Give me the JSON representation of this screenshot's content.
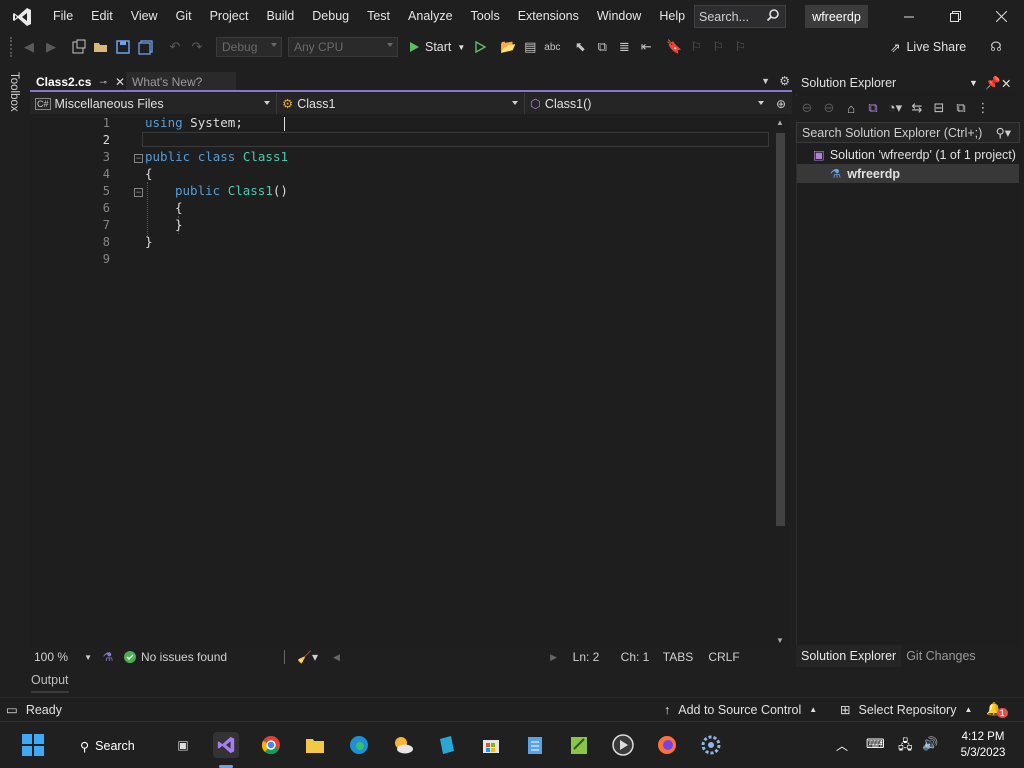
{
  "menu": [
    "File",
    "Edit",
    "View",
    "Git",
    "Project",
    "Build",
    "Debug",
    "Test",
    "Analyze",
    "Tools",
    "Extensions",
    "Window",
    "Help"
  ],
  "search": {
    "placeholder": "Search..."
  },
  "solution_badge": "wfreerdp",
  "toolbar": {
    "config": "Debug",
    "platform": "Any CPU",
    "start_label": "Start",
    "live_share": "Live Share"
  },
  "toolbox_label": "Toolbox",
  "tabs": [
    {
      "label": "Class2.cs",
      "active": true
    },
    {
      "label": "What's New?",
      "active": false
    }
  ],
  "navbar": {
    "project": "Miscellaneous Files",
    "type": "Class1",
    "member": "Class1()"
  },
  "code": {
    "line_numbers": [
      "1",
      "2",
      "3",
      "4",
      "5",
      "6",
      "7",
      "8",
      "9"
    ],
    "current_line": "2",
    "l1_kw": "using",
    "l1_rest": " System;",
    "l3_kw1": "public",
    "l3_kw2": "class",
    "l3_type": "Class1",
    "l4": "{",
    "l5_kw": "public",
    "l5_fn": "Class1",
    "l5_paren": "()",
    "l6": "{",
    "l7": "}",
    "l8": "}"
  },
  "editor_status": {
    "zoom": "100 %",
    "issues": "No issues found",
    "line": "Ln: 2",
    "char": "Ch: 1",
    "tabs": "TABS",
    "eol": "CRLF"
  },
  "output_label": "Output",
  "solution_explorer": {
    "title": "Solution Explorer",
    "search_placeholder": "Search Solution Explorer (Ctrl+;)",
    "solution_label": "Solution 'wfreerdp' (1 of 1 project)",
    "project_label": "wfreerdp",
    "tabs": [
      "Solution Explorer",
      "Git Changes"
    ]
  },
  "status": {
    "ready": "Ready",
    "source_control": "Add to Source Control",
    "repository": "Select Repository",
    "notifications": "1"
  },
  "taskbar": {
    "search_label": "Search",
    "time": "4:12 PM",
    "date": "5/3/2023"
  },
  "colors": {
    "accent": "#8a76d0",
    "keyword": "#569cd6",
    "type": "#4ec9b0",
    "method": "#dcdcaa"
  }
}
